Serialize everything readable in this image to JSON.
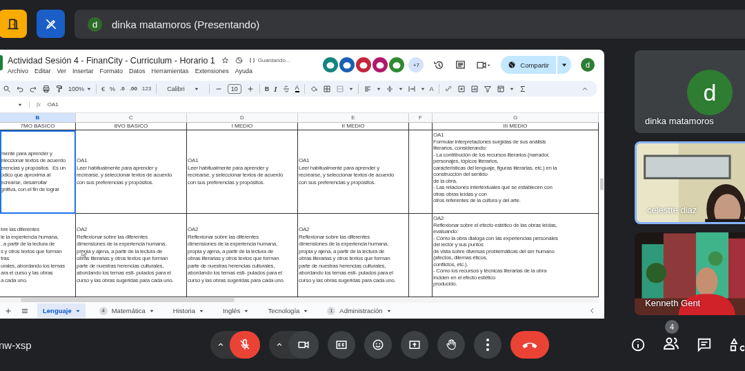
{
  "top_bar": {
    "presenter": {
      "avatar": "d",
      "label": "dinka matamoros (Presentando)"
    }
  },
  "sheet": {
    "title": "Actividad Sesión 4 - FinanCity - Curriculum - Horario 1",
    "save_status": "Guardando...",
    "menus": [
      "Archivo",
      "Editar",
      "Ver",
      "Insertar",
      "Formato",
      "Datos",
      "Herramientas",
      "Extensiones",
      "Ayuda"
    ],
    "collaborators": [
      {
        "color": "#12857c"
      },
      {
        "color": "#1a5fb4"
      },
      {
        "color": "#c4263a"
      },
      {
        "color": "#b0186a"
      },
      {
        "color": "#2f8a2f"
      }
    ],
    "collaborators_more": "+7",
    "share": "Compartir",
    "account_avatar": "d",
    "toolbar": {
      "zoom": "100%",
      "currency": "€",
      "percent": "%",
      "decrease_decimals": ".0",
      "increase_decimals": ".00",
      "number_format": "123",
      "font": "Calibri",
      "font_size": "10",
      "bold": "B",
      "italic": "I",
      "text_color": "A",
      "text_rotation": "A"
    },
    "formula_icon": "fx",
    "formula": "OA1",
    "columns": [
      {
        "letter": "B",
        "heading": "7MO BASICO",
        "selected": true
      },
      {
        "letter": "C",
        "heading": "8VO BASICO",
        "selected": false
      },
      {
        "letter": "D",
        "heading": "I MEDIO",
        "selected": false
      },
      {
        "letter": "E",
        "heading": "II MEDIO",
        "selected": false
      },
      {
        "letter": "F",
        "selected": false
      },
      {
        "letter": "G",
        "heading": "III MEDIO",
        "selected": false
      }
    ],
    "rows": [
      {
        "cells": [
          {
            "text": "mente para aprender y\neleccionar textos de acuerdo\nerencias y propósitos   Es un\núdico que aproxima al\necrearse, desarrollar\ngnitiva, con el fin de lograr",
            "selected": true
          },
          {
            "text": "OA1\nLeer habitualmente para aprender y\nrecrearse, y seleccionar textos de acuerdo\ncon sus preferencias y propósitos.",
            "selected": false
          },
          {
            "text": "OA1\nLeer habitualmente para aprender y\nrecrearse, y seleccionar textos de acuerdo\ncon sus preferencias y propósitos.",
            "selected": false
          },
          {
            "text": "OA1\nLeer habitualmente para aprender y\nrecrearse, y seleccionar textos de acuerdo\ncon sus preferencias y propósitos.",
            "selected": false
          },
          {
            "selected": false
          },
          {
            "text": "OA1\nFormular interpretaciones surgidas de sus análisis\nliterarios, considerando:\n- La contribución de los recursos literarios (narrador,\npersonajes, tópicos literarios,\ncaracterísticas del lenguaje, figuras literarias, etc.) en la\nconstrucción del sentido\nde la obra.\n- Las relaciones intertextuales que se establecen con\notras obras leídas y con\notros referentes de la cultura y del arte.",
            "selected": false
          }
        ]
      },
      {
        "cells": [
          {
            "text": "bre las diferentes\nle la experiencia humana,\n, a partir de la lectura de\ns y otros textos que forman\ntras\nurales, abordando los temas\nara el curso y las obras\na cada uno.",
            "selected": false
          },
          {
            "text": "OA2\nReflexionar sobre las diferentes\ndimensiones de la experiencia humana,\npropia y ajena, a partir de la lectura de\nobras literarias y otros textos que forman\nparte de nuestras herencias culturales,\nabordando los temas esti- pulados para el\ncurso y las obras sugeridas para cada uno.",
            "selected": false
          },
          {
            "text": "OA2\nReflexionar sobre las diferentes\ndimensiones de la experiencia humana,\npropia y ajena, a partir de la lectura de\nobras literarias y otros textos que forman\nparte de nuestras herencias culturales,\nabordando los temas esti- pulados para el\ncurso y las obras sugeridas para cada uno.",
            "selected": false
          },
          {
            "text": "OA2\nReflexionar sobre las diferentes\ndimensiones de la experiencia humana,\npropia y ajena, a partir de la lectura de\nobras literarias y otros textos que forman\nparte de nuestras herencias culturales,\nabordando los temas esti- pulados para el\ncurso y las obras sugeridas para cada uno.",
            "selected": false
          },
          {
            "selected": false
          },
          {
            "text": "OA2\nReflexionar sobre el efecto estético de las obras leídas,\nevaluando:\n- Cómo la obra dialoga con las experiencias personales\ndel lector y sus puntos\nde vista sobre diversas problemáticas del ser humano\n(afectos, dilemas éticos,\nconflictos, etc.).\n- Cómo los recursos y técnicas literarias de la obra\ninciden en el efecto estético\nproducido.",
            "selected": false
          }
        ]
      }
    ],
    "sheet_tabs": [
      {
        "label": "Lenguaje",
        "selected": true
      },
      {
        "label": "Matemática",
        "badge": "4",
        "selected": false
      },
      {
        "label": "Historia",
        "selected": false
      },
      {
        "label": "Inglés",
        "selected": false
      },
      {
        "label": "Tecnología",
        "selected": false
      },
      {
        "label": "Administración",
        "badge": "1",
        "selected": false
      }
    ]
  },
  "participants": [
    {
      "name": "dinka matamoros",
      "kind": "avatar",
      "avatar": "d",
      "active": false
    },
    {
      "name": "celestte diaz",
      "kind": "video",
      "active": true
    },
    {
      "name": "Kenneth Gent",
      "kind": "video",
      "active": false
    }
  ],
  "meeting_code": "nw-xsp",
  "controls": {
    "mic_muted": true
  },
  "people_count": "4"
}
